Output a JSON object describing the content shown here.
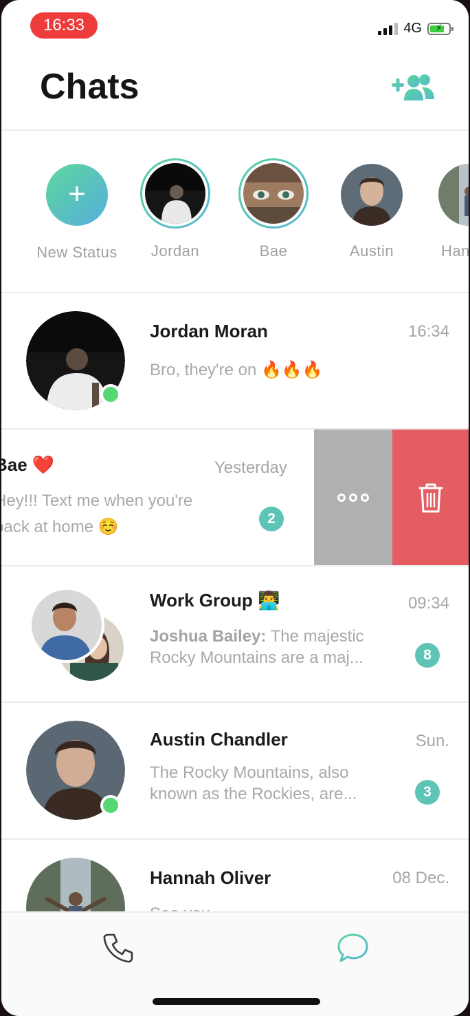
{
  "status_bar": {
    "time": "16:33",
    "network": "4G"
  },
  "header": {
    "title": "Chats",
    "add_contact_icon": "add-contact-icon"
  },
  "stories": [
    {
      "label": "New Status",
      "type": "new"
    },
    {
      "label": "Jordan",
      "type": "seen_ring"
    },
    {
      "label": "Bae",
      "type": "seen_ring"
    },
    {
      "label": "Austin",
      "type": "plain"
    },
    {
      "label": "Han",
      "type": "plain"
    }
  ],
  "chats": [
    {
      "name": "Jordan Moran",
      "time": "16:34",
      "preview": "Bro, they're on 🔥🔥🔥",
      "online": true
    },
    {
      "name": "Bae ❤️",
      "time": "Yesterday",
      "preview_line1": "Hey!!! Text me when you're",
      "preview_line2": "back at home ☺️",
      "badge": "2"
    },
    {
      "name": "Work Group 👨‍💻",
      "time": "09:34",
      "sender": "Joshua Bailey:",
      "preview_line1": "The majestic",
      "preview_line2": "Rocky Mountains are a maj...",
      "badge": "8"
    },
    {
      "name": "Austin Chandler",
      "time": "Sun.",
      "preview_line1": "The Rocky Mountains, also",
      "preview_line2": "known as the Rockies, are...",
      "badge": "3",
      "online": true
    },
    {
      "name": "Hannah Oliver",
      "time": "08 Dec.",
      "preview": "See you"
    }
  ],
  "swipe_actions": {
    "more_icon": "more-dots-icon",
    "delete_icon": "trash-icon"
  },
  "colors": {
    "accent": "#5ec4b6",
    "delete": "#e35d63",
    "more": "#b0afb2",
    "online": "#55d873",
    "time_pill": "#ee3b3b"
  }
}
